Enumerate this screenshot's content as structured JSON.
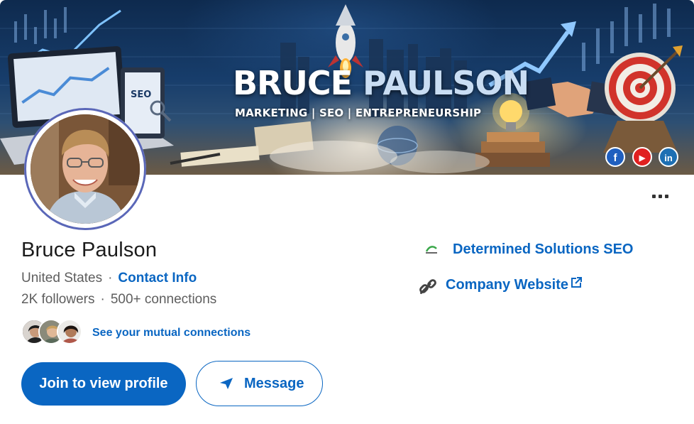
{
  "banner": {
    "title_first": "BRUCE",
    "title_last": "PAULSON",
    "subtitle": "MARKETING | SEO | ENTREPRENEURSHIP",
    "laptop_tag": "SEO",
    "social": [
      {
        "icon": "facebook-icon",
        "glyph": "f",
        "color": "#1f5fbf"
      },
      {
        "icon": "youtube-icon",
        "glyph": "▶",
        "color": "#e02020"
      },
      {
        "icon": "linkedin-icon",
        "glyph": "in",
        "color": "#1d6fb3"
      }
    ]
  },
  "profile": {
    "name": "Bruce Paulson",
    "location": "United States",
    "contact_info": "Contact Info",
    "followers": "2K followers",
    "connections": "500+ connections",
    "mutual_connections": "See your mutual connections"
  },
  "actions": {
    "join": "Join to view profile",
    "message": "Message",
    "more_icon": "more-horizontal-icon"
  },
  "sidebar": {
    "company": "Determined Solutions SEO",
    "website": "Company Website"
  },
  "colors": {
    "accent": "#0a66c2",
    "text_secondary": "#5e5e5e",
    "avatar_ring": "#5a67b8"
  }
}
